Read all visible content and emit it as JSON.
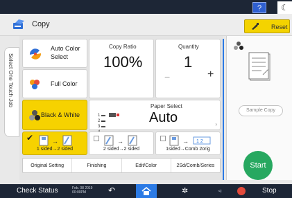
{
  "topbar": {
    "help_label": "?",
    "moon_glyph": "☾"
  },
  "header": {
    "title": "Copy",
    "reset_label": "Reset",
    "app_icon": "copy-icon"
  },
  "side_tab": {
    "label": "Select One Touch Job"
  },
  "color_modes": [
    {
      "label_lines": [
        "Auto Color",
        "Select"
      ],
      "selected": false,
      "icon": "auto-color-icon"
    },
    {
      "label": "Full Color",
      "selected": false,
      "icon": "full-color-icon"
    },
    {
      "label": "Black & White",
      "selected": true,
      "icon": "black-white-icon"
    }
  ],
  "copy_ratio": {
    "label": "Copy Ratio",
    "value": "100%"
  },
  "quantity": {
    "label": "Quantity",
    "value": "1",
    "minus": "−",
    "plus": "+"
  },
  "paper_select": {
    "label": "Paper Select",
    "value": "Auto",
    "trays": [
      "1",
      "2",
      "3",
      "4"
    ]
  },
  "sided_options": [
    {
      "label": "1 sided→2 sided",
      "selected": true
    },
    {
      "label": "2 sided→2 sided",
      "selected": false
    },
    {
      "label": "1sided→Comb 2orig",
      "selected": false
    }
  ],
  "tabs": [
    "Original Setting",
    "Finishing",
    "Edit/Color",
    "2Sd/Comb/Series"
  ],
  "right_panel": {
    "sample_copy_label": "Sample Copy",
    "start_label": "Start"
  },
  "bottombar": {
    "check_status": "Check Status",
    "date_line1": "Feb. 08 2019",
    "date_line2": "00:00PM",
    "stop_label": "Stop"
  },
  "colors": {
    "accent_yellow": "#f6d200",
    "start_green": "#27a860",
    "bar_navy": "#1d2636",
    "blue": "#2c7be5"
  }
}
